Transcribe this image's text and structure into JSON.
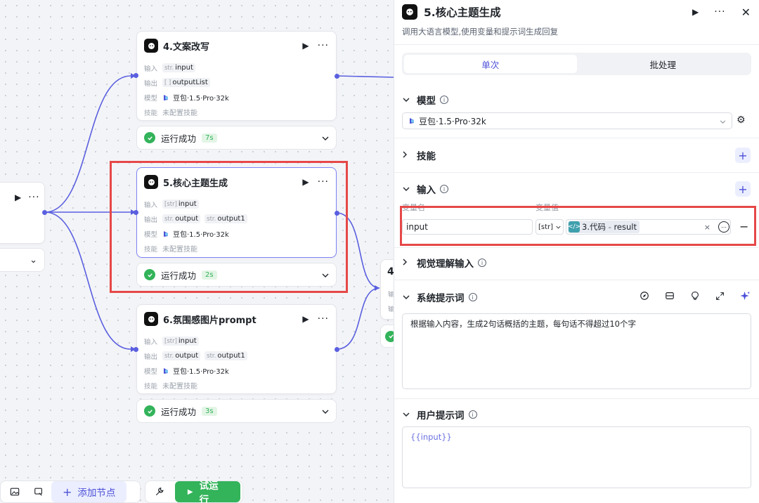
{
  "canvas": {
    "nodes": [
      {
        "id": "n4",
        "title": "4.文案改写",
        "rows": [
          {
            "k": "输入",
            "chips": [
              {
                "t": "str.",
                "v": "input"
              }
            ]
          },
          {
            "k": "输出",
            "chips": [
              {
                "t": "[ ]",
                "v": "outputList"
              }
            ]
          },
          {
            "k": "模型",
            "model": "豆包·1.5·Pro·32k"
          },
          {
            "k": "技能",
            "muted": "未配置技能"
          }
        ],
        "status": "运行成功",
        "time": "7s"
      },
      {
        "id": "n5",
        "title": "5.核心主题生成",
        "rows": [
          {
            "k": "输入",
            "chips": [
              {
                "t": "[str]",
                "v": "input"
              }
            ]
          },
          {
            "k": "输出",
            "chips": [
              {
                "t": "str.",
                "v": "output"
              },
              {
                "t": "str.",
                "v": "output1"
              }
            ]
          },
          {
            "k": "模型",
            "model": "豆包·1.5·Pro·32k"
          },
          {
            "k": "技能",
            "muted": "未配置技能"
          }
        ],
        "status": "运行成功",
        "time": "2s"
      },
      {
        "id": "n6",
        "title": "6.氛围感图片prompt",
        "rows": [
          {
            "k": "输入",
            "chips": [
              {
                "t": "[str]",
                "v": "input"
              }
            ]
          },
          {
            "k": "输出",
            "chips": [
              {
                "t": "str.",
                "v": "output"
              },
              {
                "t": "str.",
                "v": "output1"
              }
            ]
          },
          {
            "k": "模型",
            "model": "豆包·1.5·Pro·32k"
          },
          {
            "k": "技能",
            "muted": "未配置技能"
          }
        ],
        "status": "运行成功",
        "time": "3s"
      }
    ],
    "partial_node_letter": "4",
    "partial_node_row_label": "输",
    "toolbar": {
      "add_node": "添加节点",
      "test_run": "试运行"
    }
  },
  "panel": {
    "title": "5.核心主题生成",
    "description": "调用大语言模型,使用变量和提示词生成回复",
    "tabs": [
      "单次",
      "批处理"
    ],
    "model_section": {
      "title": "模型",
      "selected": "豆包·1.5·Pro·32k"
    },
    "skills_section": {
      "title": "技能"
    },
    "input_section": {
      "title": "输入",
      "col_name": "变量名",
      "col_value": "变量值",
      "var_name": "input",
      "var_type": "[str]",
      "ref_node": "3.代码",
      "ref_sep": " - ",
      "ref_field": "result"
    },
    "vision_section": {
      "title": "视觉理解输入"
    },
    "system_prompt": {
      "title": "系统提示词",
      "text": "根据输入内容，生成2句话概括的主题，每句话不得超过10个字"
    },
    "user_prompt": {
      "title": "用户提示词",
      "text": "{{input}}"
    }
  },
  "colors": {
    "accent": "#4b50d8",
    "success": "#33b35a",
    "highlight": "#e64848",
    "edge": "#5a5fe0"
  }
}
